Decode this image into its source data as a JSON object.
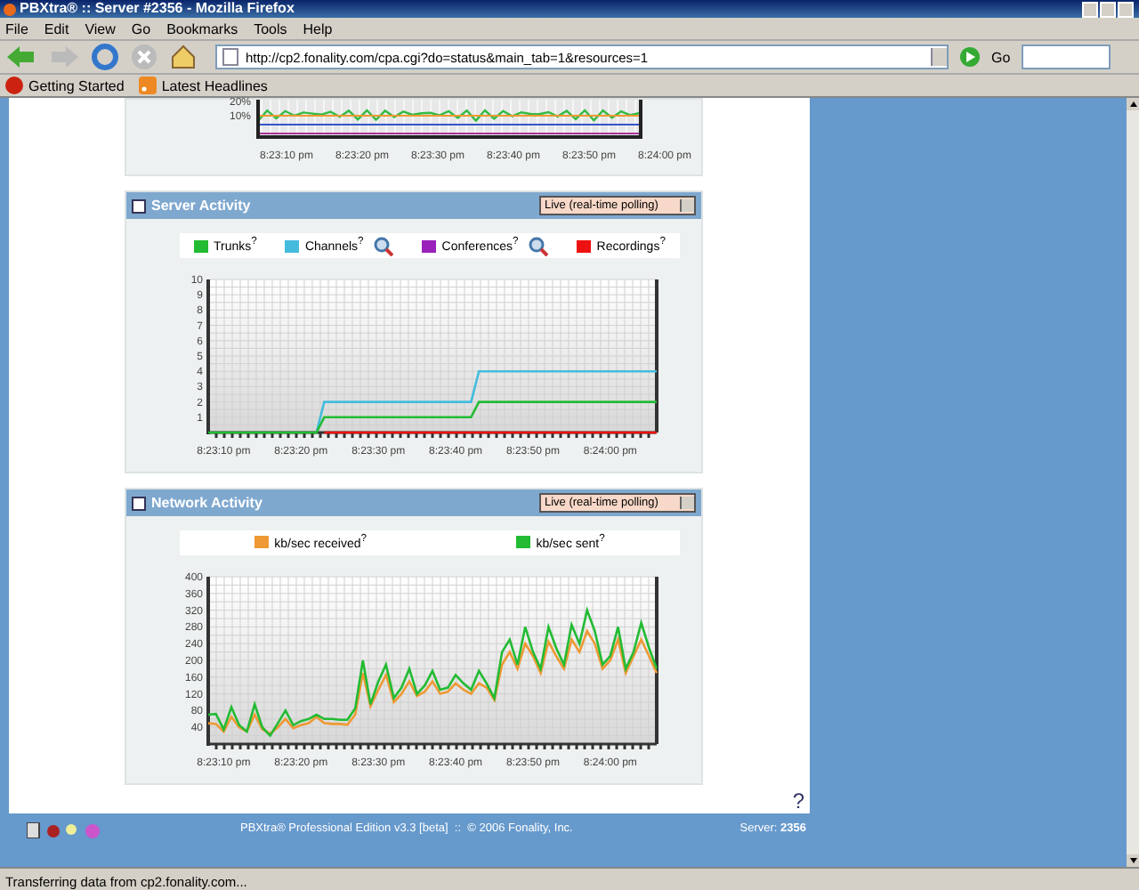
{
  "window": {
    "title": "PBXtra® :: Server #2356 - Mozilla Firefox"
  },
  "menu": [
    "File",
    "Edit",
    "View",
    "Go",
    "Bookmarks",
    "Tools",
    "Help"
  ],
  "address_bar": {
    "value": "http://cp2.fonality.com/cpa.cgi?do=status&main_tab=1&resources=1",
    "go_label": "Go"
  },
  "bookmarks": [
    {
      "label": "Getting Started",
      "kind": "page"
    },
    {
      "label": "Latest Headlines",
      "kind": "feed"
    }
  ],
  "usage_chart": {
    "ytick_labels": [
      "20%",
      "10%"
    ],
    "xtick_labels": [
      "8:23:10 pm",
      "8:23:20 pm",
      "8:23:30 pm",
      "8:23:40 pm",
      "8:23:50 pm",
      "8:24:00 pm"
    ]
  },
  "panels": [
    {
      "title": "Server Activity",
      "mode": "Live (real-time polling)",
      "legend": [
        {
          "label": "Trunks$^{?}$",
          "color": "#22bb33",
          "search_icon": false
        },
        {
          "label": "Channels$^{?}$",
          "color": "#44bbdd",
          "search_icon": true
        },
        {
          "label": "Conferences$^{?}$",
          "color": "#9922bb",
          "search_icon": true
        },
        {
          "label": "Recordings$^{?}$",
          "color": "#ee1111",
          "search_icon": false
        }
      ],
      "chart_data": {
        "type": "line",
        "categories": [
          null,
          null,
          "8:23:10 pm",
          null,
          null,
          null,
          null,
          null,
          null,
          null,
          null,
          null,
          "8:23:20 pm",
          null,
          null,
          null,
          null,
          null,
          null,
          null,
          null,
          null,
          "8:23:30 pm",
          null,
          null,
          null,
          null,
          null,
          null,
          null,
          null,
          null,
          "8:23:40 pm",
          null,
          null,
          null,
          null,
          null,
          null,
          null,
          null,
          null,
          "8:23:50 pm",
          null,
          null,
          null,
          null,
          null,
          null,
          null,
          null,
          null,
          "8:24:00 pm",
          null,
          null,
          null,
          null,
          null,
          null
        ],
        "ylim": [
          0,
          10
        ],
        "grid": true,
        "yticks": [
          1,
          2,
          3,
          4,
          5,
          6,
          7,
          8,
          9,
          10
        ],
        "series": [
          {
            "color": "#44bbdd",
            "values": [
              null,
              null,
              null,
              null,
              null,
              null,
              null,
              null,
              null,
              null,
              null,
              null,
              null,
              null,
              0,
              2,
              2,
              2,
              2,
              2,
              2,
              2,
              2,
              2,
              2,
              2,
              2,
              2,
              2,
              2,
              2,
              2,
              2,
              2,
              2,
              4,
              4,
              4,
              4,
              4,
              4,
              4,
              4,
              4,
              4,
              4,
              4,
              4,
              4,
              4,
              4,
              4,
              4,
              4,
              4,
              4,
              4,
              4,
              4
            ]
          },
          {
            "color": "#ee1111",
            "values": [
              null,
              null,
              null,
              null,
              null,
              null,
              null,
              null,
              null,
              null,
              null,
              null,
              null,
              null,
              null,
              0,
              0,
              0,
              0,
              0,
              0,
              0,
              0,
              0,
              0,
              0,
              0,
              0,
              0,
              0,
              0,
              0,
              0,
              0,
              0,
              0,
              0,
              0,
              0,
              0,
              0,
              0,
              0,
              0,
              0,
              0,
              0,
              0,
              0,
              0,
              0,
              0,
              0,
              0,
              0,
              0,
              0,
              0,
              0
            ]
          },
          {
            "color": "#22bb33",
            "values": [
              0,
              0,
              0,
              0,
              0,
              0,
              0,
              0,
              0,
              0,
              0,
              0,
              0,
              0,
              0,
              1,
              1,
              1,
              1,
              1,
              1,
              1,
              1,
              1,
              1,
              1,
              1,
              1,
              1,
              1,
              1,
              1,
              1,
              1,
              1,
              2,
              2,
              2,
              2,
              2,
              2,
              2,
              2,
              2,
              2,
              2,
              2,
              2,
              2,
              2,
              2,
              2,
              2,
              2,
              2,
              2,
              2,
              2,
              2
            ]
          }
        ]
      }
    },
    {
      "title": "Network Activity",
      "mode": "Live (real-time polling)",
      "legend": [
        {
          "label": "kb/sec received$^{?}$",
          "color": "#ee9933",
          "search_icon": false
        },
        {
          "label": "kb/sec sent$^{?}$",
          "color": "#22bb33",
          "search_icon": false
        }
      ],
      "chart_data": {
        "type": "line",
        "categories": [
          null,
          null,
          "8:23:10 pm",
          null,
          null,
          null,
          null,
          null,
          null,
          null,
          null,
          null,
          "8:23:20 pm",
          null,
          null,
          null,
          null,
          null,
          null,
          null,
          null,
          null,
          "8:23:30 pm",
          null,
          null,
          null,
          null,
          null,
          null,
          null,
          null,
          null,
          "8:23:40 pm",
          null,
          null,
          null,
          null,
          null,
          null,
          null,
          null,
          null,
          "8:23:50 pm",
          null,
          null,
          null,
          null,
          null,
          null,
          null,
          null,
          null,
          "8:24:00 pm",
          null,
          null,
          null,
          null,
          null,
          null
        ],
        "ylim": [
          0,
          400
        ],
        "grid": true,
        "yticks": [
          40,
          80,
          120,
          160,
          200,
          240,
          280,
          320,
          360,
          400
        ],
        "series": [
          {
            "color": "#ee9933",
            "values": [
              50,
              48,
              30,
              65,
              40,
              30,
              70,
              35,
              25,
              40,
              60,
              38,
              45,
              50,
              65,
              50,
              48,
              48,
              46,
              70,
              170,
              90,
              130,
              165,
              100,
              120,
              150,
              115,
              125,
              150,
              120,
              125,
              145,
              130,
              120,
              145,
              135,
              105,
              190,
              220,
              180,
              240,
              210,
              170,
              245,
              210,
              180,
              250,
              220,
              270,
              240,
              180,
              200,
              250,
              170,
              210,
              250,
              210,
              170
            ]
          },
          {
            "color": "#22bb33",
            "values": [
              70,
              72,
              35,
              88,
              45,
              30,
              95,
              40,
              20,
              50,
              80,
              45,
              55,
              60,
              70,
              60,
              60,
              58,
              58,
              85,
              200,
              95,
              150,
              190,
              110,
              135,
              180,
              120,
              140,
              175,
              130,
              135,
              165,
              145,
              130,
              175,
              145,
              110,
              220,
              250,
              190,
              280,
              220,
              180,
              280,
              230,
              190,
              285,
              240,
              320,
              270,
              190,
              210,
              280,
              180,
              220,
              290,
              230,
              180
            ]
          }
        ]
      }
    }
  ],
  "help_label": "?",
  "footer": {
    "product": "PBXtra® Professional Edition v3.3 [beta]  ::  © 2006 Fonality, Inc.",
    "server": "Server: **2356**"
  },
  "status_bar": "Transferring data from cp2.fonality.com..."
}
